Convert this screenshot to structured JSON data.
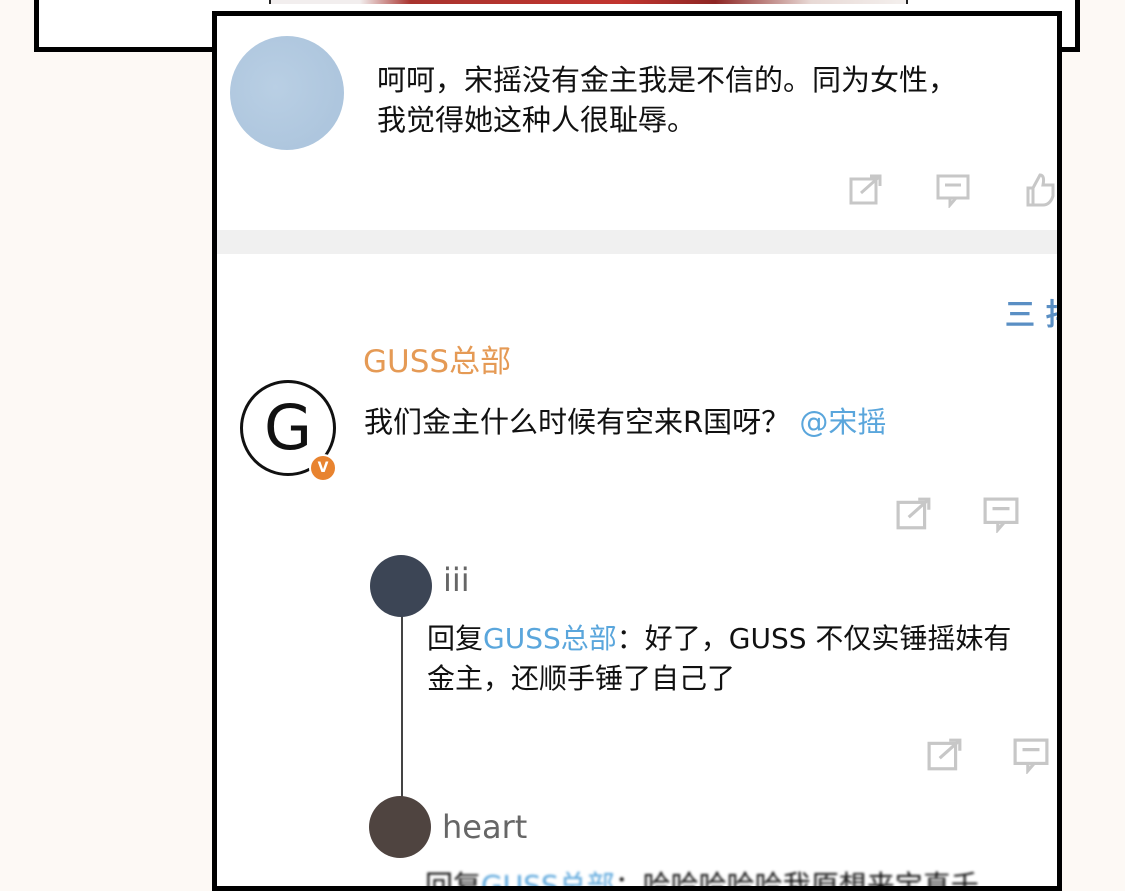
{
  "post1": {
    "text": "呵呵，宋摇没有金主我是不信的。同为女性，我觉得她这种人很耻辱。",
    "line1": "呵呵，宋摇没有金主我是不信的。同为女性，",
    "line2": "我觉得她这种人很耻辱。",
    "icons": [
      "share-icon",
      "comment-icon",
      "like-icon"
    ]
  },
  "post2": {
    "sort_label": "三 排",
    "username": "GUSS总部",
    "avatar_letter": "G",
    "verified_badge": "V",
    "text_main": "我们金主什么时候有空来R国呀？",
    "mention": "@宋摇",
    "icons": [
      "share-icon",
      "comment-icon"
    ]
  },
  "replies": [
    {
      "username": "iii",
      "reply_prefix": "回复",
      "reply_target": "GUSS总部",
      "reply_sep": "：",
      "line1": "好了，GUSS 不仅实锤摇妹有",
      "line2": "金主，还顺手锤了自己了",
      "icons": [
        "share-icon",
        "comment-icon"
      ]
    },
    {
      "username": "heart",
      "reply_prefix": "回复",
      "reply_target": "GUSS总部",
      "reply_sep": "：",
      "line1": "哈哈哈哈哈我原想来宝真千",
      "icons": []
    }
  ],
  "colors": {
    "username_orange": "#e59a55",
    "link_blue": "#5aa6dc",
    "badge_orange": "#e8832f"
  }
}
